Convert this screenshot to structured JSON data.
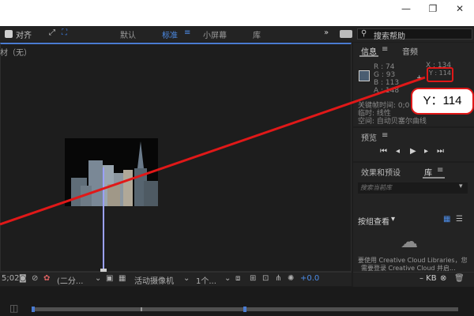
{
  "titlebar": {
    "minimize": "—",
    "restore": "❐",
    "close": "✕"
  },
  "workspace": {
    "align_label": "对齐",
    "items": [
      "默认",
      "标准",
      "小屏幕",
      "库"
    ],
    "active": "标准",
    "search_placeholder": "搜索帮助"
  },
  "comp": {
    "title": "材（无）",
    "footer": {
      "time": "5;02",
      "resolution": "(二分...",
      "camera": "活动摄像机",
      "views": "1个...",
      "exposure": "+0.0"
    }
  },
  "info_panel": {
    "tabs": [
      "信息",
      "音频"
    ],
    "r": "R : 74",
    "g": "G : 93",
    "b": "B : 113",
    "a": "A : 148",
    "x": "X : 134",
    "y": "Y : 114",
    "line1": "关键帧时间: 0;0",
    "line2": "临时: 线性",
    "line3": "空间: 自动贝塞尔曲线",
    "swatch_color": "#4a5d71"
  },
  "preview_panel": {
    "title": "预览"
  },
  "library_panel": {
    "tabs": [
      "效果和预设",
      "库"
    ],
    "search_placeholder": "搜索当前库",
    "browse_label": "按组查看",
    "cc_text1": "要使用 Creative Cloud Libraries，您",
    "cc_text2": "需要登录 Creative Cloud 并启...",
    "size_label": "– KB"
  },
  "callout": {
    "text": "Y：114"
  },
  "colors": {
    "accent": "#4a7bd1",
    "annotation": "#e01818"
  }
}
